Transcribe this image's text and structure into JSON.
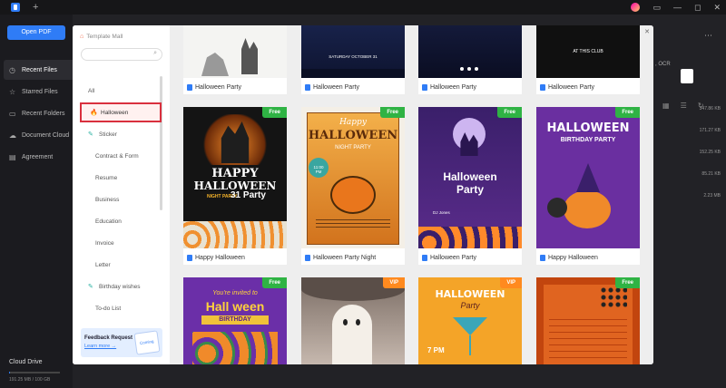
{
  "app": {
    "tab_add": "+"
  },
  "sidebar": {
    "open_pdf": "Open PDF",
    "items": [
      {
        "label": "Recent Files",
        "icon": "clock-icon",
        "active": true
      },
      {
        "label": "Starred Files",
        "icon": "star-icon"
      },
      {
        "label": "Recent Folders",
        "icon": "folder-icon"
      },
      {
        "label": "Document Cloud",
        "icon": "cloud-icon"
      },
      {
        "label": "Agreement",
        "icon": "agreement-icon"
      }
    ],
    "cloud": {
      "label": "Cloud Drive",
      "usage": "191.25 MB / 100 GB"
    }
  },
  "background": {
    "ocr_text": ", OCR",
    "sizes": [
      "347.86 KB",
      "171.27 KB",
      "152.25 KB",
      "85.21 KB",
      "2.23 MB"
    ]
  },
  "modal": {
    "title": "Template Mall",
    "search_placeholder": "",
    "categories": [
      "All",
      "Halloween",
      "Sticker",
      "Contract & Form",
      "Resume",
      "Business",
      "Education",
      "Invoice",
      "Letter",
      "Birthday wishes",
      "To-do List"
    ],
    "selected_category": "Halloween",
    "feedback": {
      "title": "Feedback Request",
      "link": "Learn more →",
      "art_text": "Coming"
    },
    "row1": [
      "Halloween Party",
      "Halloween Party",
      "Halloween Party",
      "Halloween Party"
    ],
    "row2": [
      {
        "label": "Happy Halloween",
        "badge": "Free"
      },
      {
        "label": "Halloween Party Night",
        "badge": "Free"
      },
      {
        "label": "Halloween Party",
        "badge": "Free"
      },
      {
        "label": "Happy Halloween",
        "badge": "Free"
      }
    ],
    "row3": [
      {
        "badge": "Free"
      },
      {
        "badge": "VIP"
      },
      {
        "badge": "VIP"
      },
      {
        "badge": "Free"
      }
    ],
    "thumb_text": {
      "r1c2_date": "SATURDAY OCTOBER 31",
      "r1c4_text": "AT THIS CLUB",
      "r2c1_a": "HAPPY",
      "r2c1_b": "HALLOWEEN",
      "r2c1_c": "NIGHT PARTY",
      "r2c1_d": "31 Party",
      "r2c2_a": "Happy",
      "r2c2_b": "HALLOWEEN",
      "r2c2_c": "NIGHT PARTY",
      "r2c2_d": "11:00 PM",
      "r2c3_a": "Halloween",
      "r2c3_b": "Party",
      "r2c3_c": "DJ Jones",
      "r2c4_a": "HALLOWEEN",
      "r2c4_b": "BIRTHDAY PARTY",
      "r3c1_a": "You're invited to",
      "r3c1_b": "Hall ween",
      "r3c1_c": "BIRTHDAY",
      "r3c3_a": "HALLOWEEN",
      "r3c3_b": "Party",
      "r3c3_c": "7 PM"
    }
  }
}
